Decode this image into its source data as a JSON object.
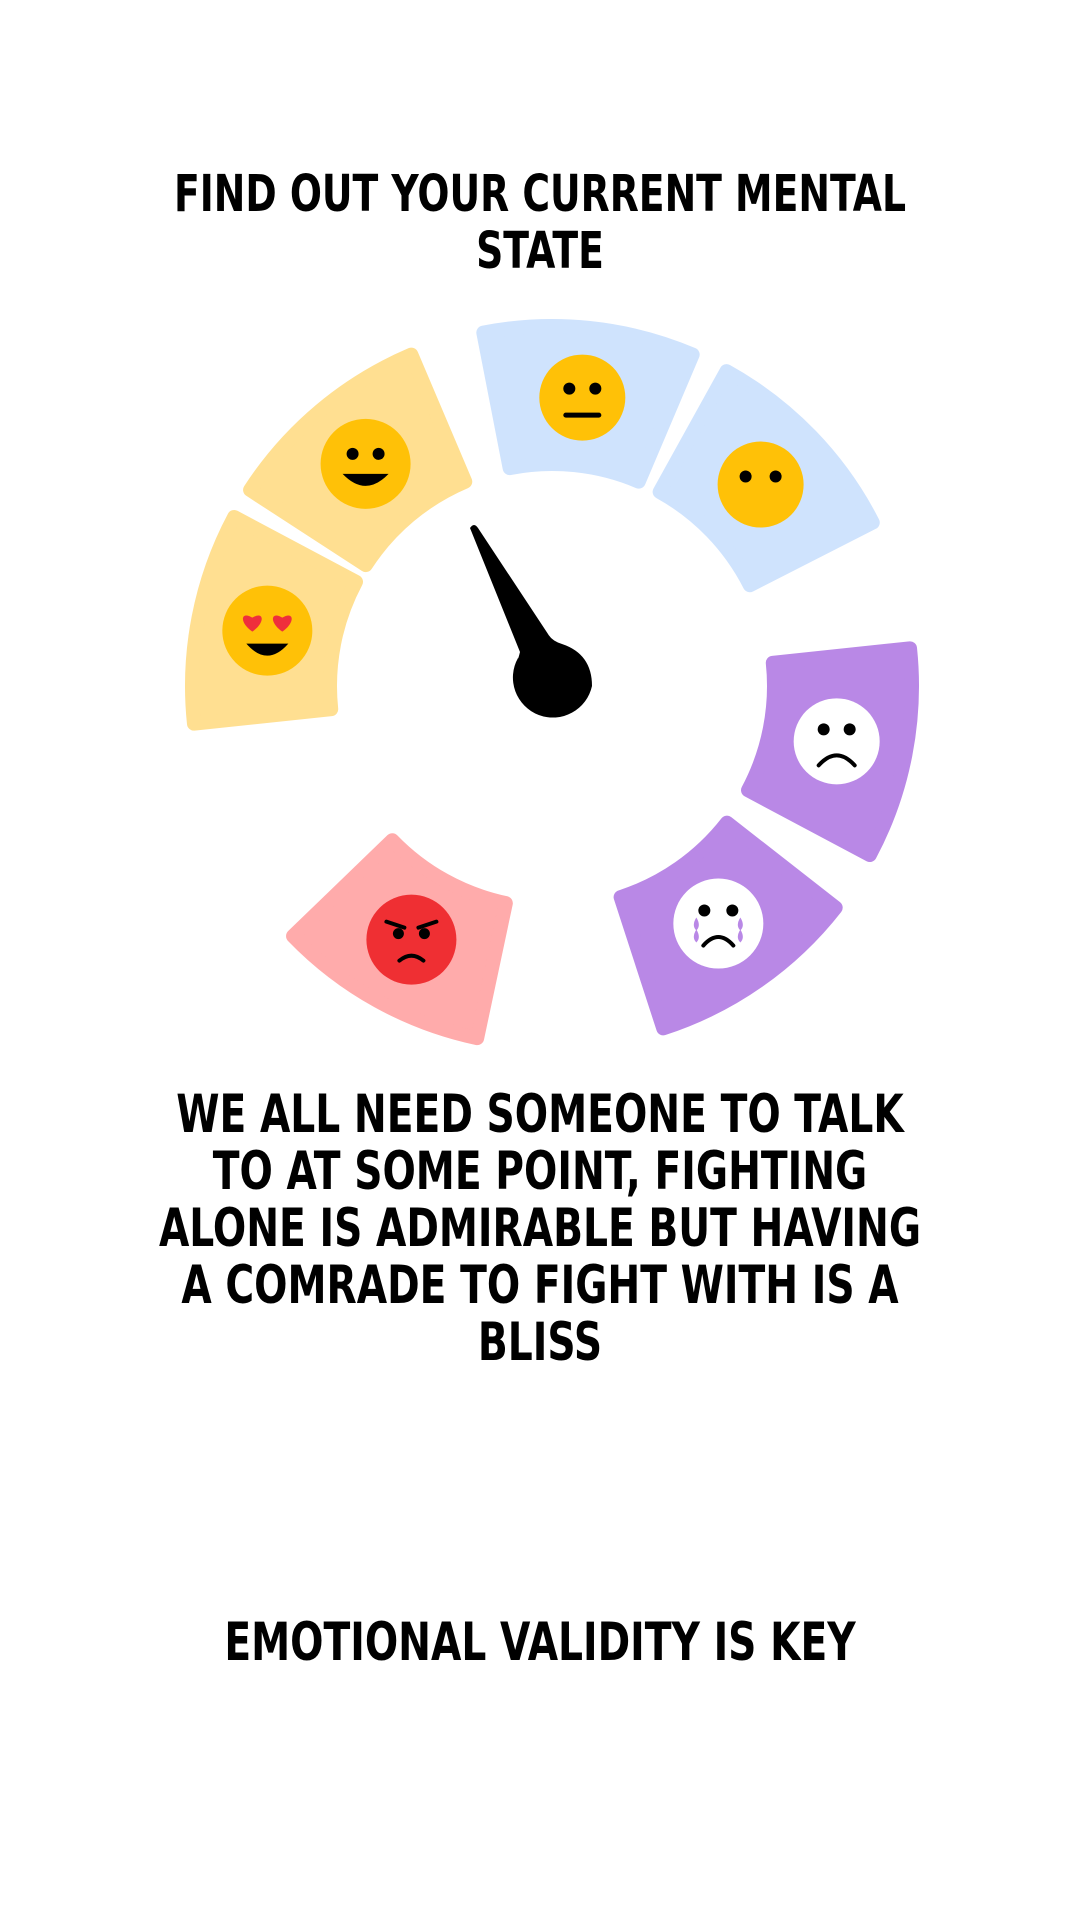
{
  "title": {
    "lines": [
      "FIND OUT YOUR CURRENT MENTAL",
      "STATE"
    ]
  },
  "mood_wheel": {
    "segments": [
      {
        "emoji": "heart-eyes-face-icon",
        "color": "#ffdf91"
      },
      {
        "emoji": "grinning-face-icon",
        "color": "#ffdf91"
      },
      {
        "emoji": "neutral-face-icon",
        "color": "#cfe3fd"
      },
      {
        "emoji": "no-mouth-face-icon",
        "color": "#cfe3fd"
      },
      {
        "emoji": "frowning-face-icon",
        "color": "#b988e6"
      },
      {
        "emoji": "crying-face-icon",
        "color": "#b988e6"
      },
      {
        "emoji": "angry-face-icon",
        "color": "#ffabab"
      }
    ],
    "pointer_target": "grinning-face-icon"
  },
  "message": {
    "lines": [
      "WE ALL NEED SOMEONE TO TALK",
      "TO AT SOME POINT, FIGHTING",
      "ALONE IS ADMIRABLE BUT HAVING",
      "A COMRADE TO FIGHT WITH IS A",
      "BLISS"
    ]
  },
  "tagline": "EMOTIONAL VALIDITY IS KEY"
}
